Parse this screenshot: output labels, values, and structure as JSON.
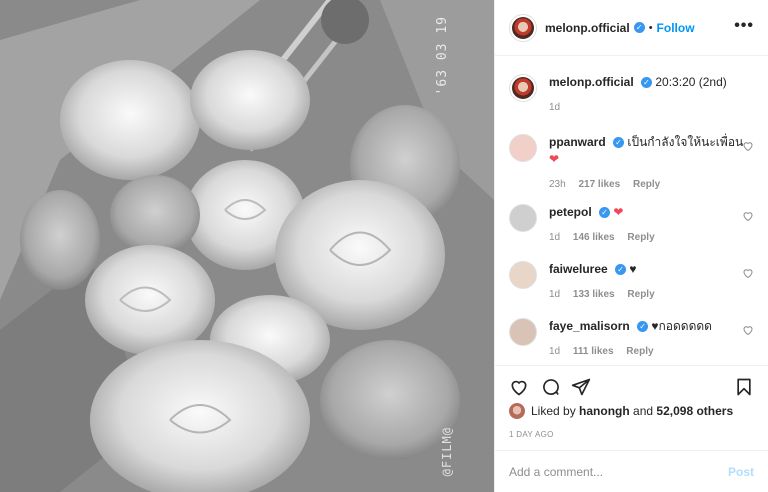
{
  "header": {
    "username": "melonp.official",
    "separator": "•",
    "follow_label": "Follow",
    "more_label": "•••"
  },
  "caption": {
    "username": "melonp.official",
    "text": "20:3:20 (2nd)",
    "time": "1d"
  },
  "comments": [
    {
      "username": "ppanward",
      "text": "เป็นกำลังใจให้นะเพื่อน",
      "emoji": "❤",
      "time": "23h",
      "likes": "217 likes",
      "reply": "Reply"
    },
    {
      "username": "petepol",
      "text": "",
      "emoji": "❤",
      "time": "1d",
      "likes": "146 likes",
      "reply": "Reply"
    },
    {
      "username": "faiweluree",
      "text": "♥",
      "emoji": "",
      "time": "1d",
      "likes": "133 likes",
      "reply": "Reply"
    },
    {
      "username": "faye_malisorn",
      "text": "♥กอดดดดด",
      "emoji": "",
      "time": "1d",
      "likes": "111 likes",
      "reply": "Reply"
    }
  ],
  "likes": {
    "prefix": "Liked by",
    "user": "hanongh",
    "and": "and",
    "count": "52,098 others"
  },
  "posted_ago": "1 DAY AGO",
  "add_comment": {
    "placeholder": "Add a comment...",
    "post_label": "Post"
  },
  "photo": {
    "stamp": "'63 03 19",
    "brand": "@FILM@"
  },
  "colors": {
    "accent": "#0095f6",
    "heart": "#ed4956",
    "post_disabled": "#b2dffc",
    "muted": "#8e8e8e"
  }
}
